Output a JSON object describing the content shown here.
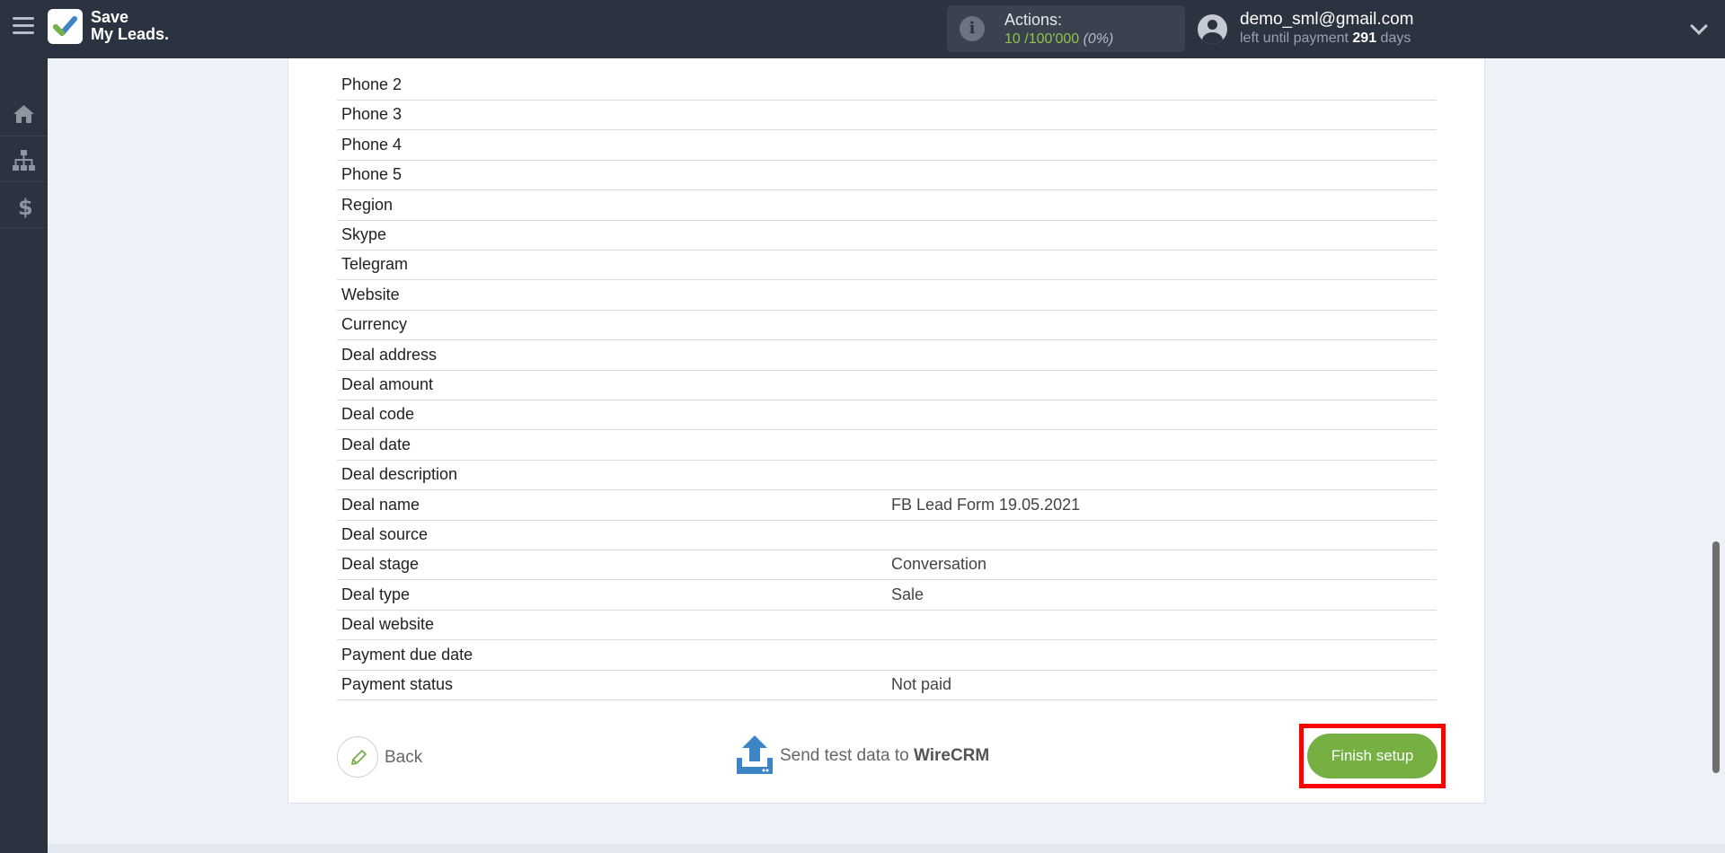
{
  "header": {
    "logo": [
      "Save",
      "My Leads."
    ],
    "actions": {
      "label": "Actions:",
      "used": "10",
      "separator": " /",
      "limit": "100'000",
      "percent": " (0%)"
    },
    "user": {
      "email": "demo_sml@gmail.com",
      "payment_prefix": "left until payment ",
      "days": "291",
      "payment_suffix": " days"
    },
    "icons": {
      "menu": "hamburger-icon",
      "info": "info-icon",
      "user": "user-circle-icon",
      "dropdown": "chevron-down-icon"
    }
  },
  "sidebar": {
    "items": [
      {
        "id": "home",
        "icon": "home-icon"
      },
      {
        "id": "connections",
        "icon": "sitemap-icon"
      },
      {
        "id": "billing",
        "icon": "dollar-icon"
      }
    ]
  },
  "fields": [
    {
      "name": "Phone 2",
      "value": ""
    },
    {
      "name": "Phone 3",
      "value": ""
    },
    {
      "name": "Phone 4",
      "value": ""
    },
    {
      "name": "Phone 5",
      "value": ""
    },
    {
      "name": "Region",
      "value": ""
    },
    {
      "name": "Skype",
      "value": ""
    },
    {
      "name": "Telegram",
      "value": ""
    },
    {
      "name": "Website",
      "value": ""
    },
    {
      "name": "Currency",
      "value": ""
    },
    {
      "name": "Deal address",
      "value": ""
    },
    {
      "name": "Deal amount",
      "value": ""
    },
    {
      "name": "Deal code",
      "value": ""
    },
    {
      "name": "Deal date",
      "value": ""
    },
    {
      "name": "Deal description",
      "value": ""
    },
    {
      "name": "Deal name",
      "value": "FB Lead Form 19.05.2021"
    },
    {
      "name": "Deal source",
      "value": ""
    },
    {
      "name": "Deal stage",
      "value": "Conversation"
    },
    {
      "name": "Deal type",
      "value": "Sale"
    },
    {
      "name": "Deal website",
      "value": ""
    },
    {
      "name": "Payment due date",
      "value": ""
    },
    {
      "name": "Payment status",
      "value": "Not paid"
    }
  ],
  "footer": {
    "back_label": "Back",
    "send_test_prefix": "Send test data to ",
    "send_test_target": "WireCRM",
    "finish_label": "Finish setup"
  },
  "colors": {
    "topbar": "#2c3340",
    "accent_green": "#76b043",
    "highlight": "#ff0000",
    "upload_blue": "#3d85c6"
  }
}
